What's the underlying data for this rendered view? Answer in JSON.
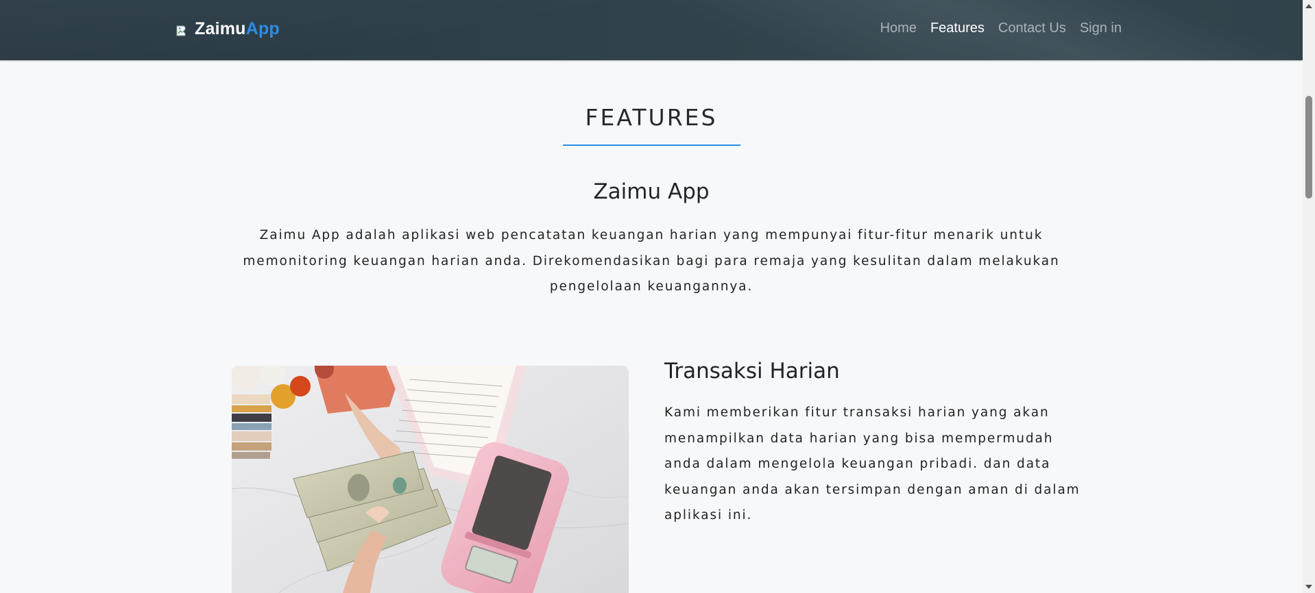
{
  "navbar": {
    "brand_primary": "Zaimu",
    "brand_accent": "App",
    "logo_icon": "broken-image-icon",
    "links": [
      {
        "label": "Home",
        "active": false
      },
      {
        "label": "Features",
        "active": true
      },
      {
        "label": "Contact Us",
        "active": false
      },
      {
        "label": "Sign in",
        "active": false
      }
    ]
  },
  "section": {
    "title": "FEATURES",
    "app_heading": "Zaimu App",
    "intro": "Zaimu App adalah aplikasi web pencatatan keuangan harian yang mempunyai fitur-fitur menarik untuk memonitoring keuangan harian anda. Direkomendasikan bagi para remaja yang kesulitan dalam melakukan pengelolaan keuangannya."
  },
  "feature": {
    "title": "Transaksi Harian",
    "description": "Kami memberikan fitur transaksi harian yang akan menampilkan data harian yang bisa mempermudah anda dalam mengelola keuangan pribadi. dan data keuangan anda akan tersimpan dengan aman di dalam aplikasi ini."
  },
  "colors": {
    "accent": "#2b8de6",
    "navbar_bg": "#334651",
    "page_bg": "#f7f8fa"
  }
}
